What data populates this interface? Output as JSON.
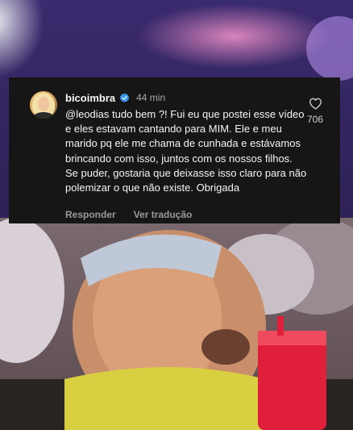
{
  "comment": {
    "username": "bicoimbra",
    "time": "44 min",
    "text": "@leodias tudo bem ?! Fui eu que postei esse vídeo e eles estavam cantando para MIM. Ele e meu marido pq ele me chama de cunhada e estávamos brincando com isso, juntos com os nossos filhos. Se puder, gostaria que deixasse isso claro para não polemizar o que não existe. Obrigada",
    "like_count": "706",
    "reply_label": "Responder",
    "translate_label": "Ver tradução",
    "verified_icon": "verified-badge-icon",
    "like_icon": "heart-icon"
  },
  "colors": {
    "card_background": "#161616",
    "verified_blue": "#3897f0",
    "text_primary": "#f5f5f5",
    "text_secondary": "#a8a8a8"
  }
}
